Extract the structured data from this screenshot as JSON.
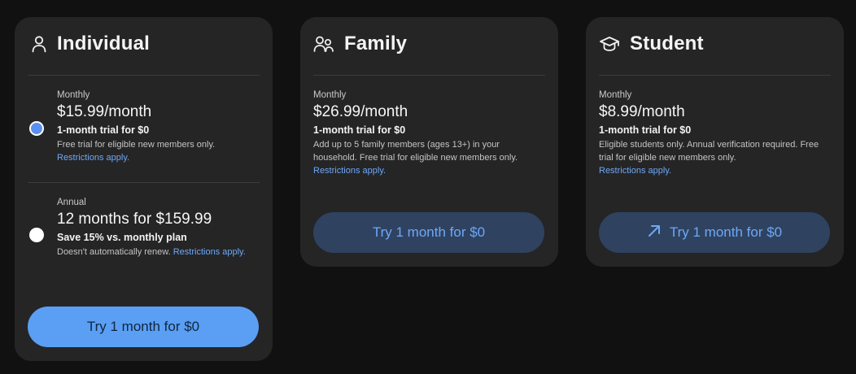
{
  "individual": {
    "title": "Individual",
    "icon": "person-icon",
    "monthly": {
      "period": "Monthly",
      "price": "$15.99/month",
      "trial": "1-month trial for $0",
      "desc": "Free trial for eligible new members only.",
      "link": "Restrictions apply.",
      "selected": true
    },
    "annual": {
      "period": "Annual",
      "price": "12 months for $159.99",
      "trial": "Save 15% vs. monthly plan",
      "desc": "Doesn't automatically renew.",
      "link": "Restrictions apply.",
      "selected": false
    },
    "cta": "Try 1 month for $0"
  },
  "family": {
    "title": "Family",
    "icon": "group-icon",
    "period": "Monthly",
    "price": "$26.99/month",
    "trial": "1-month trial for $0",
    "desc": "Add up to 5 family members (ages 13+) in your household. Free trial for eligible new members only.",
    "link": "Restrictions apply.",
    "cta": "Try 1 month for $0"
  },
  "student": {
    "title": "Student",
    "icon": "graduation-cap-icon",
    "period": "Monthly",
    "price": "$8.99/month",
    "trial": "1-month trial for $0",
    "desc": "Eligible students only. Annual verification required. Free trial for eligible new members only.",
    "link": "Restrictions apply.",
    "cta": "Try 1 month for $0",
    "cta_icon": "arrow-up-right-icon"
  },
  "colors": {
    "background": "#111111",
    "card": "#252526",
    "accent": "#5a9ff4",
    "link": "#6ea8f7",
    "secondary_button": "#2f4260"
  }
}
